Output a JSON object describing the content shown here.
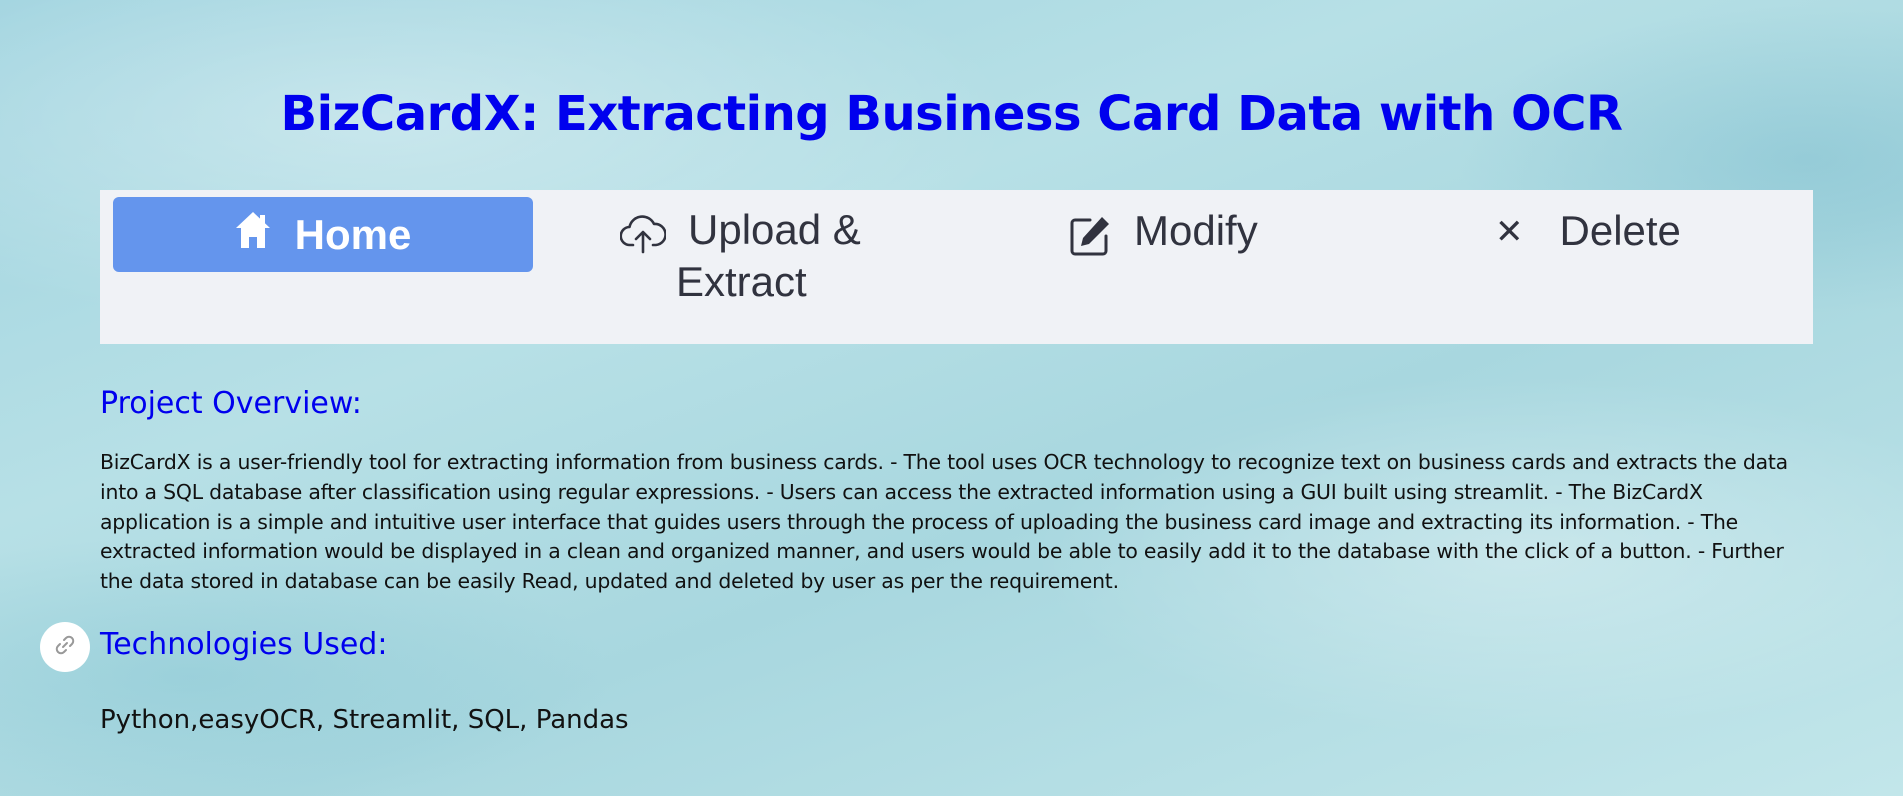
{
  "header": {
    "title": "BizCardX: Extracting Business Card Data with OCR"
  },
  "nav": {
    "items": [
      {
        "label": "Home",
        "icon": "home-icon",
        "selected": true
      },
      {
        "label": "Upload &",
        "label_line2": "Extract",
        "icon": "cloud-upload-icon",
        "selected": false
      },
      {
        "label": "Modify",
        "icon": "edit-icon",
        "selected": false
      },
      {
        "label": "Delete",
        "icon": "close-icon",
        "selected": false
      }
    ]
  },
  "main": {
    "overview_heading": "Project Overview:",
    "overview_text": "BizCardX is a user-friendly tool for extracting information from business cards. - The tool uses OCR technology to recognize text on business cards and extracts the data into a SQL database after classification using regular expressions. - Users can access the extracted information using a GUI built using streamlit. - The BizCardX application is a simple and intuitive user interface that guides users through the process of uploading the business card image and extracting its information. - The extracted information would be displayed in a clean and organized manner, and users would be able to easily add it to the database with the click of a button. - Further the data stored in database can be easily Read, updated and deleted by user as per the requirement.",
    "tech_heading": "Technologies Used:",
    "tech_text": "Python,easyOCR, Streamlit, SQL, Pandas"
  },
  "colors": {
    "heading": "#0000ee",
    "nav_selected_bg": "#6495ed",
    "nav_bg": "#f0f2f6",
    "text": "#111111"
  }
}
